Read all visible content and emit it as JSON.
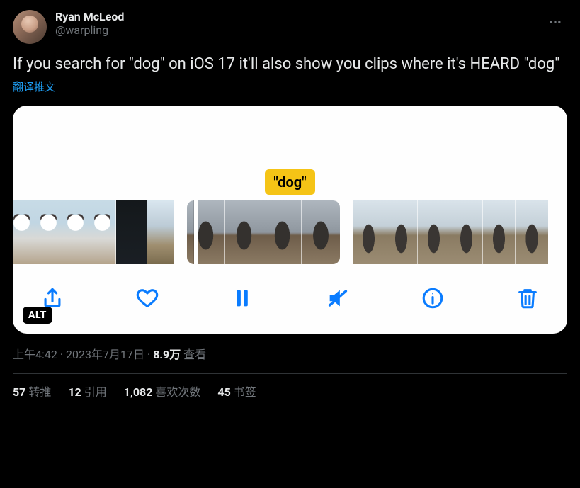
{
  "author": {
    "display_name": "Ryan McLeod",
    "handle": "@warpling"
  },
  "tweet_text": "If you search for \"dog\" on iOS 17 it'll also show you clips where it's HEARD \"dog\"",
  "translate_label": "翻译推文",
  "media": {
    "search_token": "\"dog\"",
    "alt_badge": "ALT"
  },
  "meta": {
    "time": "上午4:42",
    "date": "2023年7月17日",
    "views_count": "8.9万",
    "views_label": "查看"
  },
  "stats": {
    "retweets_count": "57",
    "retweets_label": "转推",
    "quotes_count": "12",
    "quotes_label": "引用",
    "likes_count": "1,082",
    "likes_label": "喜欢次数",
    "bookmarks_count": "45",
    "bookmarks_label": "书签"
  }
}
